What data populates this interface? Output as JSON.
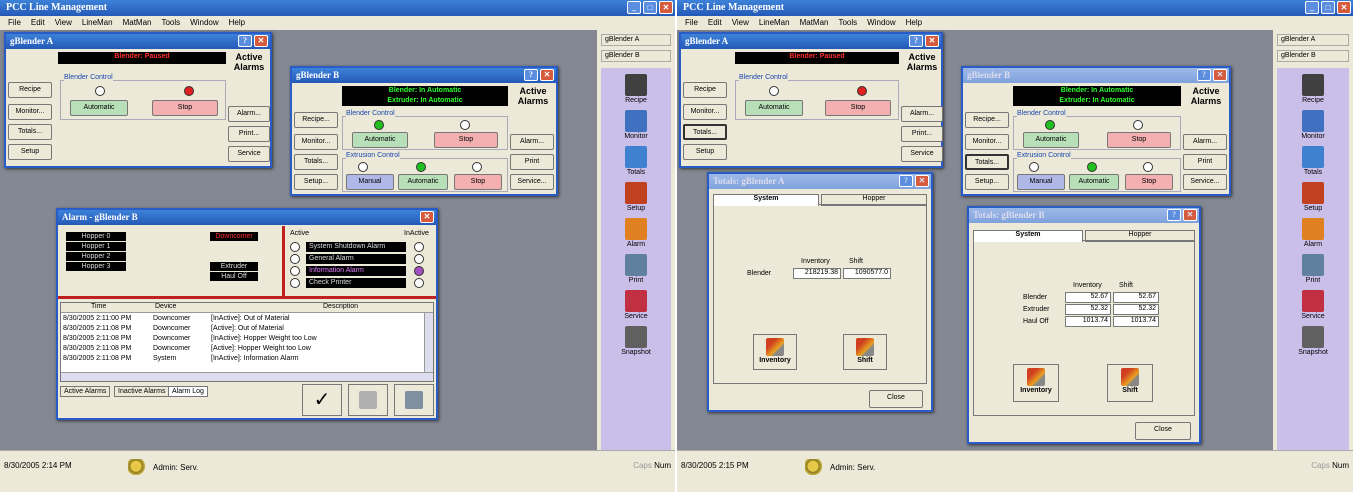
{
  "app": {
    "title": "PCC Line Management"
  },
  "menu": [
    "File",
    "Edit",
    "View",
    "LineMan",
    "MatMan",
    "Tools",
    "Window",
    "Help"
  ],
  "sidebar": {
    "tabs": [
      "gBlender A",
      "gBlender B"
    ],
    "tools": [
      {
        "label": "Recipe",
        "icon": "fork-knife-icon",
        "color": "#404040"
      },
      {
        "label": "Monitor",
        "icon": "monitor-icon",
        "color": "#4070c0"
      },
      {
        "label": "Totals",
        "icon": "calculator-icon",
        "color": "#4080d0"
      },
      {
        "label": "Setup",
        "icon": "tools-icon",
        "color": "#c04020"
      },
      {
        "label": "Alarm",
        "icon": "alarm-bell-icon",
        "color": "#e08020"
      },
      {
        "label": "Print",
        "icon": "printer-icon",
        "color": "#6080a0"
      },
      {
        "label": "Service",
        "icon": "service-icon",
        "color": "#c03040"
      },
      {
        "label": "Snapshot",
        "icon": "camera-icon",
        "color": "#606060"
      }
    ]
  },
  "status": {
    "date_left": "8/30/2005  2:14 PM",
    "date_right": "8/30/2005  2:15 PM",
    "user": "Admin: Serv.",
    "caps": "Caps",
    "num": "Num"
  },
  "blender_a": {
    "title": "gBlender A",
    "status": "Blender: Paused",
    "active_alarms": "Active Alarms",
    "control_group": "Blender Control",
    "left_buttons": [
      "Recipe",
      "Monitor...",
      "Totals...",
      "Setup"
    ],
    "right_buttons": [
      "Alarm...",
      "Print...",
      "Service"
    ],
    "automatic": "Automatic",
    "stop": "Stop"
  },
  "blender_b": {
    "title": "gBlender B",
    "status1": "Blender: In Automatic",
    "status2": "Extruder: In Automatic",
    "active_alarms": "Active Alarms",
    "blender_control": "Blender Control",
    "extrusion_control": "Extrusion Control",
    "left_buttons": [
      "Recipe...",
      "Monitor...",
      "Totals...",
      "Setup..."
    ],
    "right_buttons_left_pane": [
      "Alarm...",
      "Print",
      "Service..."
    ],
    "right_buttons_right_pane": [
      "Alarm...",
      "Print",
      "Service..."
    ],
    "manual": "Manual",
    "automatic": "Automatic",
    "stop": "Stop"
  },
  "alarm": {
    "title": "Alarm - gBlender B",
    "hoppers": [
      "Hopper 0",
      "Hopper 1",
      "Hopper 2",
      "Hopper 3"
    ],
    "downcomer": "Downcomer",
    "extruder": "Extruder",
    "hauloff": "Haul Off",
    "active_label": "Active",
    "inactive_label": "InActive",
    "alarm_types": [
      "System Shutdown Alarm",
      "General Alarm",
      "Information Alarm",
      "Check Printer"
    ],
    "columns": [
      "Time",
      "Device",
      "Description"
    ],
    "rows": [
      {
        "time": "8/30/2005 2:11:00 PM",
        "device": "Downcomer",
        "desc": "[InActive]: Out of Material"
      },
      {
        "time": "8/30/2005 2:11:08 PM",
        "device": "Downcomer",
        "desc": "[Active]: Out of Material"
      },
      {
        "time": "8/30/2005 2:11:08 PM",
        "device": "Downcomer",
        "desc": "[InActive]: Hopper Weight too Low"
      },
      {
        "time": "8/30/2005 2:11:08 PM",
        "device": "Downcomer",
        "desc": "[Active]: Hopper Weight too Low"
      },
      {
        "time": "8/30/2005 2:11:08 PM",
        "device": "System",
        "desc": "[InActive]: Information Alarm"
      }
    ],
    "tabs": [
      "Active Alarms",
      "Inactive Alarms",
      "Alarm Log"
    ]
  },
  "totals_a": {
    "title": "Totals: gBlender A",
    "tabs": [
      "System",
      "Hopper"
    ],
    "col_inv": "Inventory",
    "col_shift": "Shift",
    "rows": [
      {
        "label": "Blender",
        "inv": "218219.38",
        "shift": "1090577.0"
      }
    ],
    "inventory_btn": "Inventory",
    "shift_btn": "Shift",
    "close": "Close"
  },
  "totals_b": {
    "title": "Totals: gBlender B",
    "tabs": [
      "System",
      "Hopper"
    ],
    "col_inv": "Inventory",
    "col_shift": "Shift",
    "rows": [
      {
        "label": "Blender",
        "inv": "52.67",
        "shift": "52.67"
      },
      {
        "label": "Extruder",
        "inv": "52.32",
        "shift": "52.32"
      },
      {
        "label": "Haul Off",
        "inv": "1013.74",
        "shift": "1013.74"
      }
    ],
    "inventory_btn": "Inventory",
    "shift_btn": "Shift",
    "close": "Close"
  }
}
